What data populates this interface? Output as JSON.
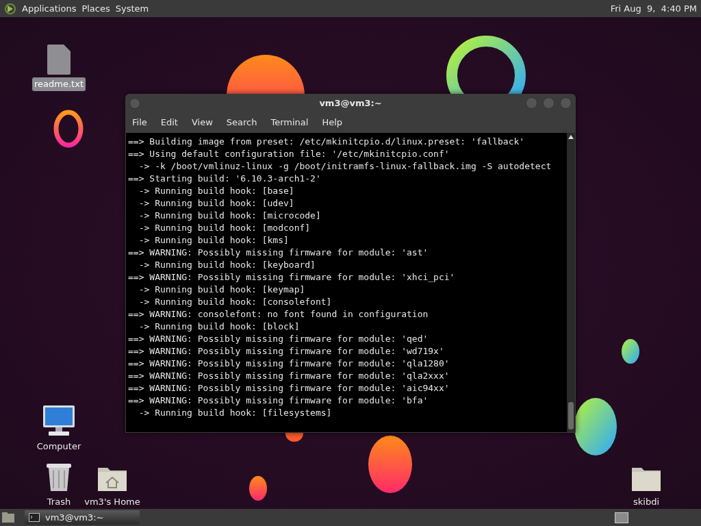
{
  "top_panel": {
    "menus": [
      "Applications",
      "Places",
      "System"
    ],
    "clock": "Fri Aug  9,  4:40 PM"
  },
  "desktop_icons": [
    {
      "kind": "file",
      "label": "readme.txt",
      "selected": true
    },
    {
      "kind": "computer",
      "label": "Computer",
      "selected": false
    },
    {
      "kind": "trash",
      "label": "Trash",
      "selected": false
    },
    {
      "kind": "home",
      "label": "vm3's Home",
      "selected": false
    },
    {
      "kind": "folder",
      "label": "skibdi",
      "selected": false
    }
  ],
  "window": {
    "title": "vm3@vm3:~",
    "menu": [
      "File",
      "Edit",
      "View",
      "Search",
      "Terminal",
      "Help"
    ],
    "lines": [
      "==> Building image from preset: /etc/mkinitcpio.d/linux.preset: 'fallback'",
      "==> Using default configuration file: '/etc/mkinitcpio.conf'",
      "  -> -k /boot/vmlinuz-linux -g /boot/initramfs-linux-fallback.img -S autodetect",
      "==> Starting build: '6.10.3-arch1-2'",
      "  -> Running build hook: [base]",
      "  -> Running build hook: [udev]",
      "  -> Running build hook: [microcode]",
      "  -> Running build hook: [modconf]",
      "  -> Running build hook: [kms]",
      "==> WARNING: Possibly missing firmware for module: 'ast'",
      "  -> Running build hook: [keyboard]",
      "==> WARNING: Possibly missing firmware for module: 'xhci_pci'",
      "  -> Running build hook: [keymap]",
      "  -> Running build hook: [consolefont]",
      "==> WARNING: consolefont: no font found in configuration",
      "  -> Running build hook: [block]",
      "==> WARNING: Possibly missing firmware for module: 'qed'",
      "==> WARNING: Possibly missing firmware for module: 'wd719x'",
      "==> WARNING: Possibly missing firmware for module: 'qla1280'",
      "==> WARNING: Possibly missing firmware for module: 'qla2xxx'",
      "==> WARNING: Possibly missing firmware for module: 'aic94xx'",
      "==> WARNING: Possibly missing firmware for module: 'bfa'",
      "  -> Running build hook: [filesystems]"
    ]
  },
  "taskbar": {
    "tasks": [
      {
        "label": "vm3@vm3:~",
        "selected": true
      }
    ]
  }
}
